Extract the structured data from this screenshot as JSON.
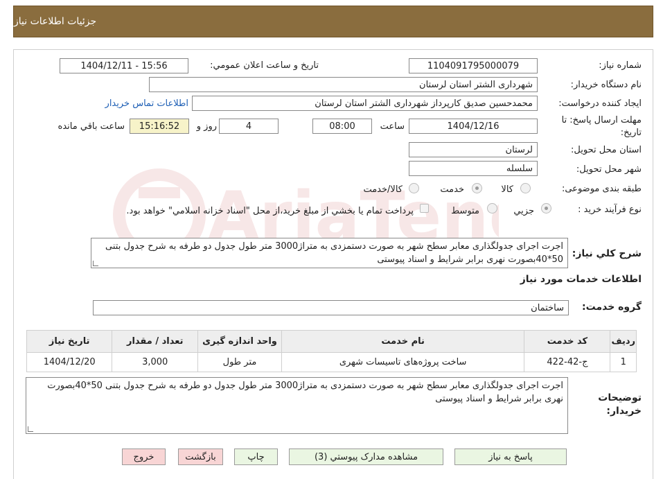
{
  "header": {
    "title": "جزئيات اطلاعات نياز"
  },
  "fields": {
    "need_number_label": "شماره نياز:",
    "need_number": "1104091795000079",
    "announce_label": "تاريخ و ساعت اعلان عمومي:",
    "announce_value": "1404/12/11 - 15:56",
    "buyer_org_label": "نام دستگاه خريدار:",
    "buyer_org": "شهرداری الشتر استان لرستان",
    "creator_label": "ايجاد کننده درخواست:",
    "creator": "محمدحسین صدیق کارپرداز شهرداری الشتر استان لرستان",
    "contact_link": "اطلاعات تماس خريدار",
    "deadline_label_1": "مهلت ارسال پاسخ: تا",
    "deadline_label_2": "تاريخ:",
    "deadline_date": "1404/12/16",
    "time_label": "ساعت",
    "deadline_time": "08:00",
    "days_value": "4",
    "days_label": "روز و",
    "remaining_time": "15:16:52",
    "remaining_label": "ساعت باقي مانده",
    "province_label": "استان محل تحويل:",
    "province": "لرستان",
    "city_label": "شهر محل تحويل:",
    "city": "سلسله",
    "category_label": "طبقه بندی موضوعی:",
    "category_options": [
      "کالا",
      "خدمت",
      "کالا/خدمت"
    ],
    "category_selected": "خدمت",
    "process_label": "نوع فرآيند خريد :",
    "process_options": [
      "جزيي",
      "متوسط"
    ],
    "process_selected": "جزيي",
    "payment_note": "پرداخت تمام يا بخشي از مبلغ خريد،از محل \"اسناد خزانه اسلامي\" خواهد بود.",
    "summary_label": "شرح کلي نياز:",
    "summary": "اجرت اجرای جدولگذاری معابر سطح شهر به صورت دستمزدی به متراژ3000 متر طول جدول دو طرفه به شرح جدول بتنی 50*40بصورت نهری برابر شرایط و اسناد پیوستی"
  },
  "services_section": {
    "title": "اطلاعات خدمات مورد نياز",
    "group_label": "گروه خدمت:",
    "group_value": "ساختمان"
  },
  "table": {
    "headers": [
      "رديف",
      "کد خدمت",
      "نام خدمت",
      "واحد اندازه گيری",
      "تعداد / مقدار",
      "تاريخ نياز"
    ],
    "rows": [
      {
        "row": "1",
        "code": "ج-42-422",
        "name": "ساخت پروژه‌های تاسیسات شهری",
        "unit": "متر طول",
        "qty": "3,000",
        "date": "1404/12/20"
      }
    ]
  },
  "notes": {
    "label_1": "توضيحات",
    "label_2": "خريدار:",
    "text": "اجرت اجرای جدولگذاری معابر سطح شهر به صورت دستمزدی به متراژ3000 متر طول جدول دو طرفه به شرح جدول بتنی 50*40بصورت نهری برابر شرایط و اسناد پیوستی"
  },
  "buttons": {
    "reply": "پاسخ به نياز",
    "attachments": "مشاهده مدارک پيوستي (3)",
    "print": "چاپ",
    "back": "بازگشت",
    "exit": "خروج"
  },
  "colors": {
    "header_bg": "#8a6d3e",
    "button_green": "#eaf6e2",
    "button_pink": "#f8d5d5",
    "remaining_bg": "#f7f3c9",
    "link": "#1e5fb5"
  }
}
